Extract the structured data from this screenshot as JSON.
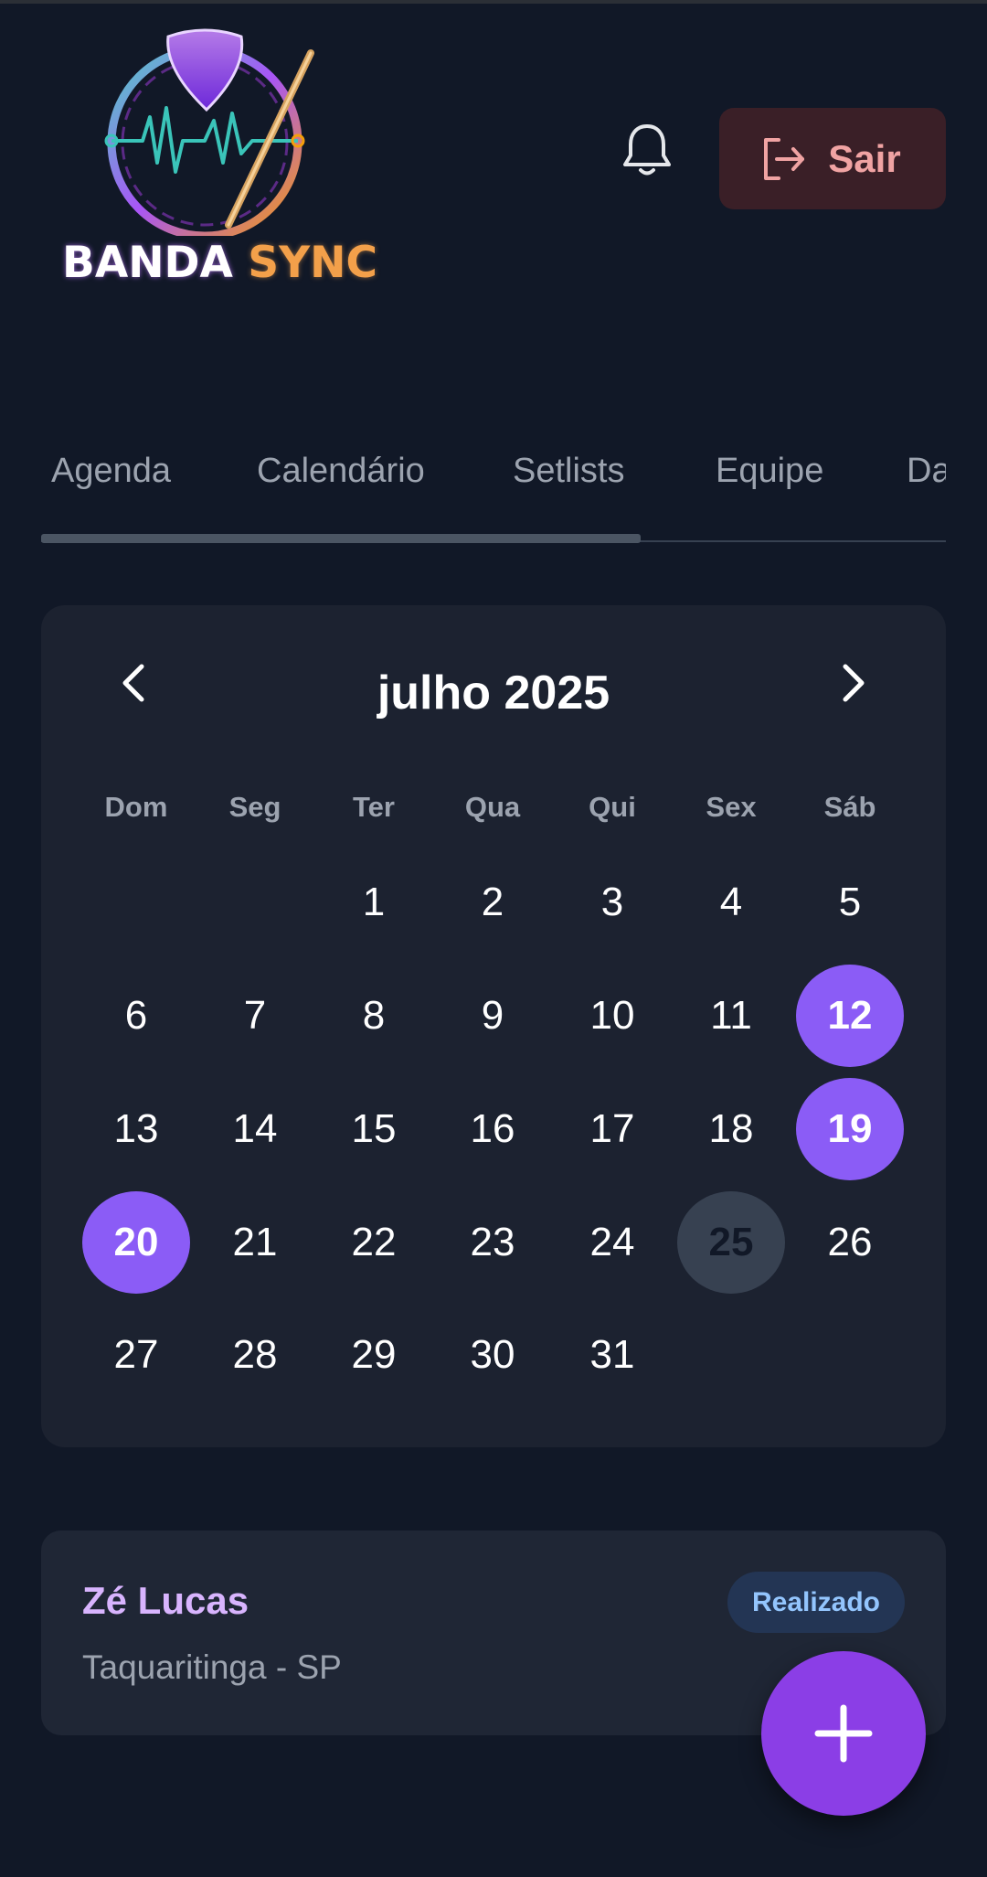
{
  "app": {
    "logo_word_1": "BANDA",
    "logo_word_2": "SYNC"
  },
  "header": {
    "notification_icon": "bell-icon",
    "logout_icon": "sign-out-icon",
    "logout_label": "Sair",
    "logout_color": "#f0a3a3"
  },
  "tabs": [
    {
      "label": "Agenda"
    },
    {
      "label": "Calendário"
    },
    {
      "label": "Setlists"
    },
    {
      "label": "Equipe"
    },
    {
      "label": "Da"
    }
  ],
  "calendar": {
    "month_title": "julho 2025",
    "prev_icon": "chevron-left-icon",
    "next_icon": "chevron-right-icon",
    "weekdays": [
      "Dom",
      "Seg",
      "Ter",
      "Qua",
      "Qui",
      "Sex",
      "Sáb"
    ],
    "weeks": [
      [
        "",
        "",
        "1",
        "2",
        "3",
        "4",
        "5"
      ],
      [
        "6",
        "7",
        "8",
        "9",
        "10",
        "11",
        "12"
      ],
      [
        "13",
        "14",
        "15",
        "16",
        "17",
        "18",
        "19"
      ],
      [
        "20",
        "21",
        "22",
        "23",
        "24",
        "25",
        "26"
      ],
      [
        "27",
        "28",
        "29",
        "30",
        "31",
        "",
        ""
      ]
    ],
    "event_days": [
      "12",
      "19",
      "20"
    ],
    "today": "25",
    "event_color": "#8b5cf6"
  },
  "event": {
    "title": "Zé Lucas",
    "location": "Taquaritinga - SP",
    "status": "Realizado"
  },
  "fab": {
    "icon": "plus-icon",
    "color": "#8b3ee6"
  }
}
